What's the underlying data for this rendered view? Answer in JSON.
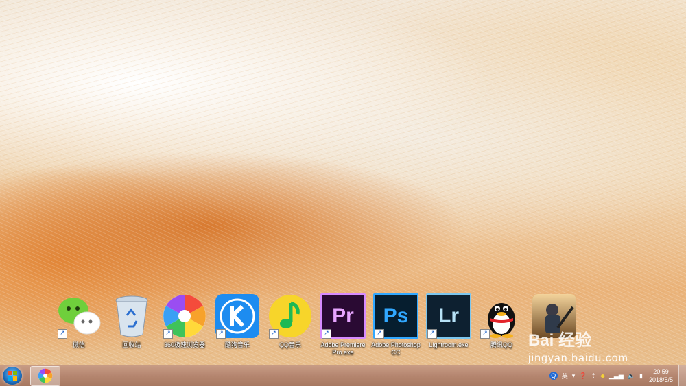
{
  "desktop": {
    "icons": [
      {
        "label": "微信",
        "icon": "wechat-icon"
      },
      {
        "label": "回收站",
        "icon": "recycle-bin-icon"
      },
      {
        "label": "360极速浏览器",
        "icon": "browser-360-icon"
      },
      {
        "label": "酷狗音乐",
        "icon": "kugou-music-icon"
      },
      {
        "label": "QQ音乐",
        "icon": "qq-music-icon"
      },
      {
        "label": "Adobe Premiere Pro.exe",
        "icon": "premiere-icon",
        "text": "Pr"
      },
      {
        "label": "Adobe Photoshop CC",
        "icon": "photoshop-icon",
        "text": "Ps"
      },
      {
        "label": "Lightroom.exe",
        "icon": "lightroom-icon",
        "text": "Lr"
      },
      {
        "label": "腾讯QQ",
        "icon": "qq-penguin-icon"
      },
      {
        "label": "",
        "icon": "game-icon"
      }
    ]
  },
  "watermark": {
    "logo": "Bai 经验",
    "url": "jingyan.baidu.com"
  },
  "taskbar": {
    "tray": {
      "ime": "英",
      "lang_indicator": "Q"
    },
    "clock": {
      "time": "20:59",
      "date": "2018/5/5"
    }
  }
}
